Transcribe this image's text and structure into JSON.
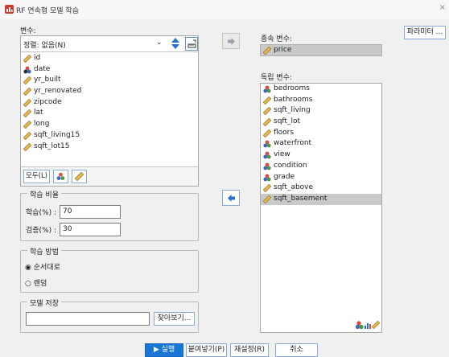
{
  "window": {
    "title": "RF 연속형 모델 학습",
    "close": "×"
  },
  "variables": {
    "label": "변수:",
    "sort_label": "정렬: 없음(N)",
    "items": [
      {
        "name": "id",
        "type": "scale"
      },
      {
        "name": "date",
        "type": "date"
      },
      {
        "name": "yr_built",
        "type": "scale"
      },
      {
        "name": "yr_renovated",
        "type": "scale"
      },
      {
        "name": "zipcode",
        "type": "scale"
      },
      {
        "name": "lat",
        "type": "scale"
      },
      {
        "name": "long",
        "type": "scale"
      },
      {
        "name": "sqft_living15",
        "type": "scale"
      },
      {
        "name": "sqft_lot15",
        "type": "scale"
      }
    ],
    "filter_all": "모두(L)"
  },
  "train_ratio": {
    "title": "학습 비율",
    "train_label": "학습(%) :",
    "train_value": "70",
    "validate_label": "검증(%) :",
    "validate_value": "30"
  },
  "train_method": {
    "title": "학습 방법",
    "options": [
      {
        "label": "순서대로",
        "checked": true
      },
      {
        "label": "랜덤",
        "checked": false
      }
    ]
  },
  "model_save": {
    "title": "모델 저장",
    "path": "",
    "browse": "찾아보기..."
  },
  "dependent": {
    "label": "종속 변수:",
    "item": "price"
  },
  "independent": {
    "label": "독립 변수:",
    "items": [
      {
        "name": "bedrooms",
        "type": "nominal",
        "selected": false
      },
      {
        "name": "bathrooms",
        "type": "scale",
        "selected": false
      },
      {
        "name": "sqft_living",
        "type": "scale",
        "selected": false
      },
      {
        "name": "sqft_lot",
        "type": "scale",
        "selected": false
      },
      {
        "name": "floors",
        "type": "scale",
        "selected": false
      },
      {
        "name": "waterfront",
        "type": "nominal",
        "selected": false
      },
      {
        "name": "view",
        "type": "nominal",
        "selected": false
      },
      {
        "name": "condition",
        "type": "nominal",
        "selected": false
      },
      {
        "name": "grade",
        "type": "nominal",
        "selected": false
      },
      {
        "name": "sqft_above",
        "type": "scale",
        "selected": false
      },
      {
        "name": "sqft_basement",
        "type": "scale",
        "selected": true
      }
    ]
  },
  "buttons": {
    "params": "파라미터 ...",
    "run": "실행",
    "paste": "붙여넣기(P)",
    "reset": "재설정(R)",
    "cancel": "취소"
  },
  "colors": {
    "accent": "#1976d2",
    "ruler": "#c9a032",
    "nominal_red": "#d94c3c",
    "nominal_blue": "#3a66c8"
  }
}
